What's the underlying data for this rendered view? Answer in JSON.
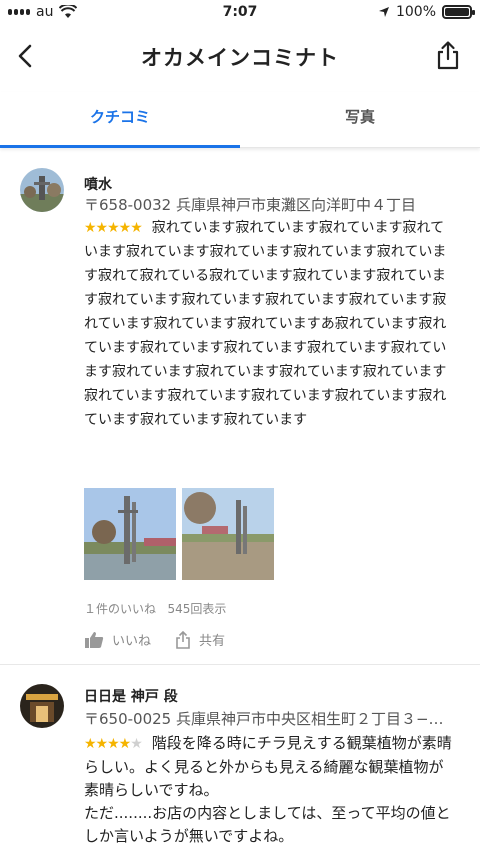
{
  "status": {
    "carrier": "au",
    "time": "7:07",
    "battery": "100%"
  },
  "header": {
    "title": "オカメインコミナト"
  },
  "tabs": [
    {
      "label": "クチコミ",
      "active": true
    },
    {
      "label": "写真",
      "active": false
    }
  ],
  "reviews": [
    {
      "name": "噴水",
      "address": "〒658-0032 兵庫県神戸市東灘区向洋町中４丁目",
      "rating": 5,
      "text": "寂れています寂れています寂れています寂れています寂れています寂れています寂れています寂れています寂れて寂れている寂れています寂れています寂れています寂れています寂れています寂れています寂れています寂れています寂れています寂れていますあ寂れています寂れています寂れています寂れています寂れています寂れています寂れています寂れています寂れています寂れています寂れています寂れています寂れています寂れています寂れています寂れています寂れています",
      "likes": "１件のいいね",
      "views": "545回表示",
      "like_label": "いいね",
      "share_label": "共有"
    },
    {
      "name": "日日是 神戸 段",
      "address": "〒650-0025 兵庫県神戸市中央区相生町２丁目３−…",
      "rating": 4,
      "text": "階段を降る時にチラ見えする観葉植物が素晴らしい。よく見ると外からも見える綺麗な観葉植物が素晴らしいですね。\nただ........お店の内容としましては、至って平均の値としか言いようが無いですよね。"
    }
  ],
  "colors": {
    "accent": "#1a73e8",
    "star": "#f5b400"
  }
}
